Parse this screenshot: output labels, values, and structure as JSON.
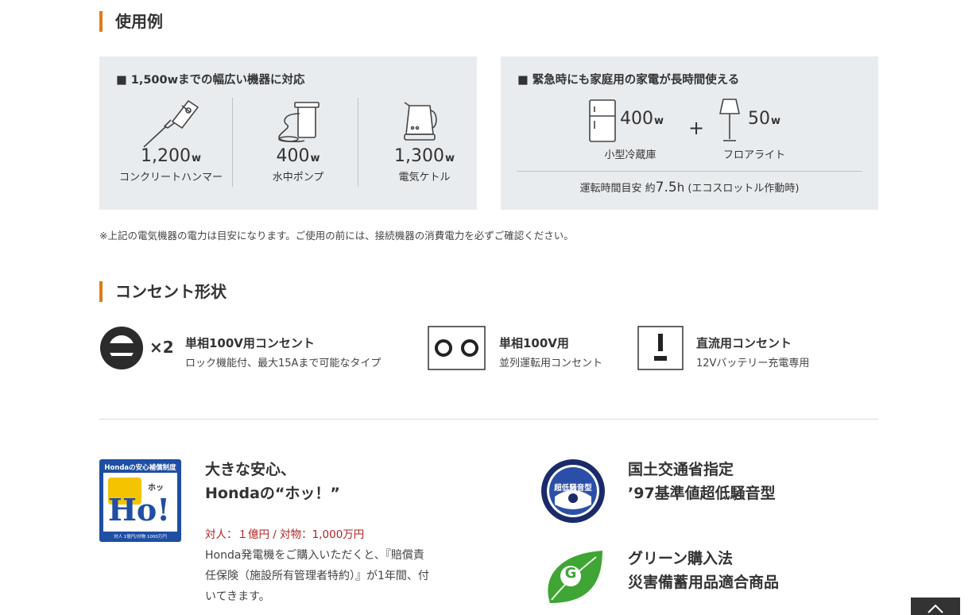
{
  "sections": {
    "usage_title": "使用例",
    "outlet_title": "コンセント形状"
  },
  "left_panel": {
    "heading": "■ 1,500wまでの幅広い機器に対応",
    "items": [
      {
        "icon": "hammer-icon",
        "watt": "1,200",
        "unit": "w",
        "label": "コンクリートハンマー"
      },
      {
        "icon": "pump-icon",
        "watt": "400",
        "unit": "w",
        "label": "水中ポンプ"
      },
      {
        "icon": "kettle-icon",
        "watt": "1,300",
        "unit": "w",
        "label": "電気ケトル"
      }
    ]
  },
  "right_panel": {
    "heading": "■ 緊急時にも家庭用の家電が長時間使える",
    "items": [
      {
        "icon": "fridge-icon",
        "watt": "400",
        "unit": "w",
        "label": "小型冷蔵庫"
      },
      {
        "icon": "lamp-icon",
        "watt": "50",
        "unit": "w",
        "label": "フロアライト"
      }
    ],
    "plus": "+",
    "runtime_prefix": "運転時間目安 約",
    "runtime_value": "7.5",
    "runtime_unit": "h",
    "runtime_suffix": " (エコスロットル作動時)"
  },
  "note": "※上記の電気機器の電力は目安になります。ご使用の前には、接続機器の消費電力を必ずご確認ください。",
  "outlets": [
    {
      "icon": "locking-outlet-icon",
      "multiplier": "×2",
      "title": "単相100V用コンセント",
      "desc": "ロック機能付、最大15Aまで可能なタイプ"
    },
    {
      "icon": "parallel-outlet-icon",
      "title": "単相100V用",
      "desc": "並列運転用コンセント"
    },
    {
      "icon": "dc-outlet-icon",
      "title": "直流用コンセント",
      "desc": "12Vバッテリー充電専用"
    }
  ],
  "features": {
    "honda": {
      "badge_header": "Hondaの安心補償制度",
      "badge_mark": "ホッ",
      "badge_main": "Ho!",
      "badge_footer": "対人 1億円/対物 1000万円",
      "title_line1": "大きな安心、",
      "title_line2": "Hondaの“ホッ！”",
      "coverage": "対人：１億円 / 対物：1,000万円",
      "desc_line1": "Honda発電機をご購入いただくと、『賠償責",
      "desc_line2": "任保険（施設所有管理者特約）』が1年間、付",
      "desc_line3": "いてきます。"
    },
    "mlit": {
      "badge_text": "超低騒音型",
      "title_line1": "国土交通省指定",
      "title_line2": "’97基準値超低騒音型"
    },
    "green": {
      "badge_letter": "G",
      "title_line1": "グリーン購入法",
      "title_line2": "災害備蓄用品適合商品"
    }
  },
  "colors": {
    "accent": "#e07b16",
    "panel_bg": "#e9ecef",
    "coverage_red": "#b22222",
    "honda_blue": "#1f4ea3",
    "green_leaf": "#3fa535"
  }
}
